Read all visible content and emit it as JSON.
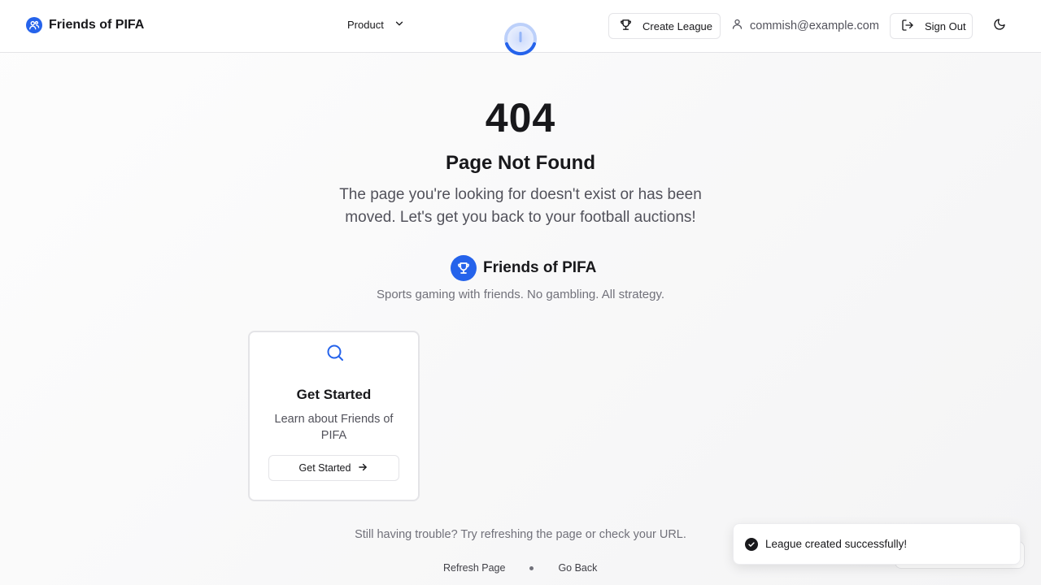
{
  "header": {
    "brand": "Friends of PIFA",
    "nav_product": "Product",
    "create_league": "Create League",
    "user_email": "commish@example.com",
    "sign_out": "Sign Out"
  },
  "main": {
    "error_code": "404",
    "title": "Page Not Found",
    "description": "The page you're looking for doesn't exist or has been moved. Let's get you back to your football auctions!",
    "brand": "Friends of PIFA",
    "tagline": "Sports gaming with friends. No gambling. All strategy.",
    "card": {
      "title": "Get Started",
      "description": "Learn about Friends of PIFA",
      "button": "Get Started"
    },
    "trouble_text": "Still having trouble? Try refreshing the page or check your URL.",
    "refresh_link": "Refresh Page",
    "back_link": "Go Back"
  },
  "toast": {
    "message": "League created successfully!"
  },
  "colors": {
    "accent": "#2563eb",
    "text": "#18181b",
    "muted": "#71717a"
  },
  "icons": [
    "users-icon",
    "chevron-down-icon",
    "trophy-icon",
    "user-icon",
    "log-out-icon",
    "moon-icon",
    "search-icon",
    "arrow-right-icon",
    "check-circle-icon",
    "loading-spinner-icon"
  ]
}
